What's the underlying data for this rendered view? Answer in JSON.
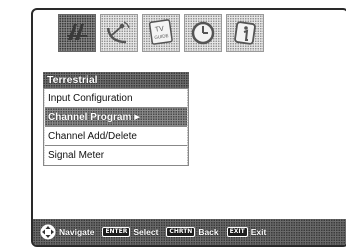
{
  "icons": [
    {
      "name": "setup-icon",
      "selected": true
    },
    {
      "name": "satellite-icon",
      "selected": false
    },
    {
      "name": "tv-guide-icon",
      "label": "TV GUIDE",
      "selected": false
    },
    {
      "name": "timer-icon",
      "selected": false
    },
    {
      "name": "info-icon",
      "selected": false
    }
  ],
  "menu": {
    "title": "Terrestrial",
    "items": [
      {
        "label": "Input Configuration",
        "selected": false
      },
      {
        "label": "Channel Program",
        "selected": true
      },
      {
        "label": "Channel Add/Delete",
        "selected": false
      },
      {
        "label": "Signal Meter",
        "selected": false
      }
    ],
    "submenu_arrow": "▶"
  },
  "footer": {
    "navigate": "Navigate",
    "enter_key": "ENTER",
    "select": "Select",
    "chrtn_key": "CHRTN",
    "back": "Back",
    "exit_key": "EXIT",
    "exit": "Exit"
  }
}
